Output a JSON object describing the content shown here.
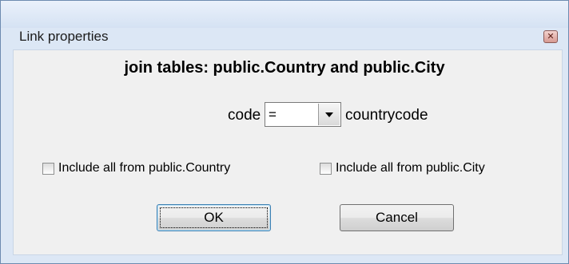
{
  "dialog": {
    "title": "Link properties",
    "heading": "join tables: public.Country and public.City"
  },
  "condition": {
    "left_field": "code",
    "operator": "=",
    "right_field": "countrycode"
  },
  "options": [
    {
      "label": "Include all from public.Country",
      "checked": false
    },
    {
      "label": "Include all from public.City",
      "checked": false
    }
  ],
  "buttons": {
    "ok": "OK",
    "cancel": "Cancel"
  },
  "icons": {
    "close": "close-icon",
    "dropdown": "chevron-down-icon"
  }
}
